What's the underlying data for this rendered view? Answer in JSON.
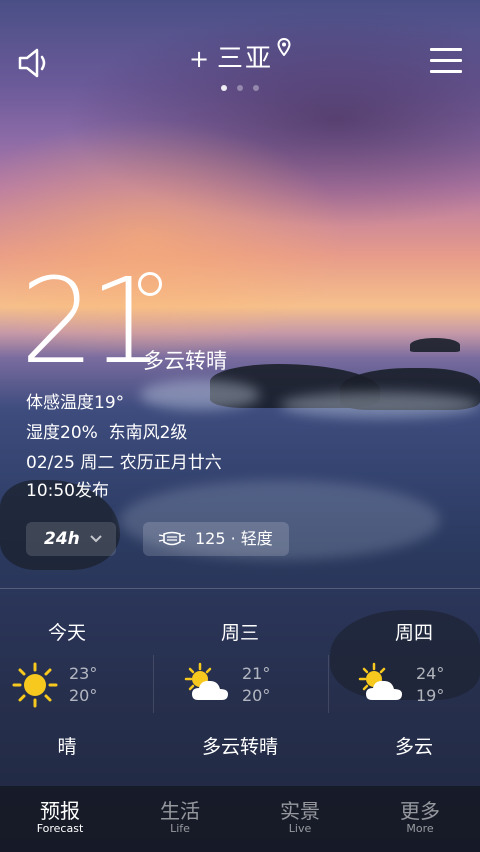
{
  "header": {
    "plus": "+",
    "city": "三亚",
    "page_count": 3,
    "active_page": 0
  },
  "current": {
    "temperature": "21",
    "condition": "多云转晴",
    "feels_like": "体感温度19°",
    "humidity_wind": "湿度20%  东南风2级",
    "date": "02/25 周二 农历正月廿六",
    "published": "10:50发布"
  },
  "controls": {
    "range_label": "24h",
    "aqi_label": "125 · 轻度"
  },
  "forecast": [
    {
      "day": "今天",
      "icon": "sun-icon",
      "high": "23°",
      "low": "20°",
      "condition": "晴"
    },
    {
      "day": "周三",
      "icon": "partly-cloudy-icon",
      "high": "21°",
      "low": "20°",
      "condition": "多云转晴"
    },
    {
      "day": "周四",
      "icon": "partly-cloudy-icon",
      "high": "24°",
      "low": "19°",
      "condition": "多云"
    }
  ],
  "tabs": [
    {
      "zh": "预报",
      "en": "Forecast",
      "active": true
    },
    {
      "zh": "生活",
      "en": "Life",
      "active": false
    },
    {
      "zh": "实景",
      "en": "Live",
      "active": false
    },
    {
      "zh": "更多",
      "en": "More",
      "active": false
    }
  ],
  "colors": {
    "sun": "#f7c81e",
    "cloud": "#ffffff"
  }
}
